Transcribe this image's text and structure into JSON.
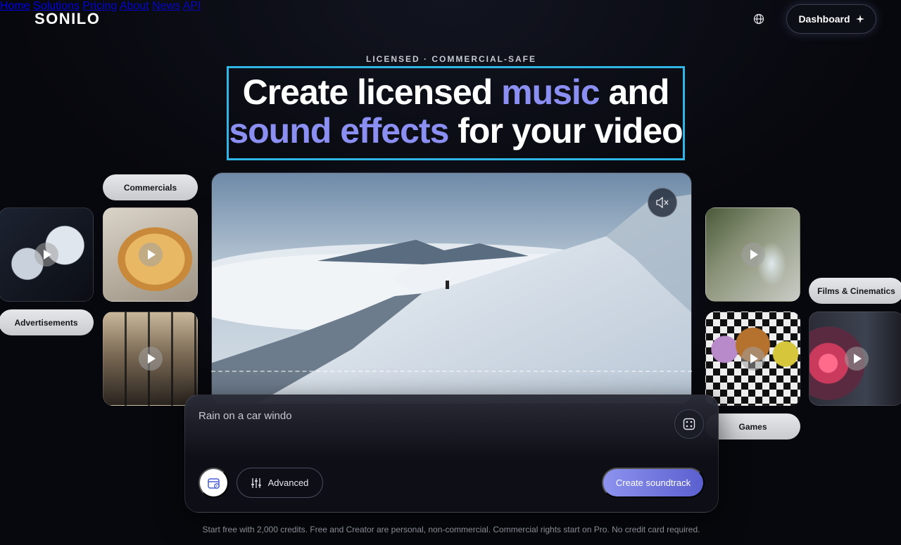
{
  "header": {
    "logo": "SONILO",
    "nav": [
      "Home",
      "Solutions",
      "Pricing",
      "About",
      "News",
      "API"
    ],
    "dashboard_label": "Dashboard",
    "dashboard_icon": "sparkle-icon",
    "language_icon": "globe-icon"
  },
  "hero": {
    "eyebrow": "LICENSED · COMMERCIAL-SAFE",
    "headline_line1_a": "Create licensed ",
    "headline_line1_accent": "music",
    "headline_line1_b": " and",
    "headline_line2_accent": "sound effects",
    "headline_line2_b": " for your video",
    "accent_color": "#8b8ff2",
    "box_color": "#2fb6e6"
  },
  "categories": {
    "commercials": "Commercials",
    "advertisements": "Advertisements",
    "films": "Films & Cinematics",
    "games": "Games"
  },
  "prompt": {
    "text": "Rain on a car windo",
    "advanced_label": "Advanced",
    "create_label": "Create soundtrack",
    "create_gradient": [
      "#8d93ee",
      "#5a5fcf"
    ]
  },
  "footnote": "Start free with 2,000 credits. Free and Creator are personal, non-commercial. Commercial rights start on Pro. No credit card required."
}
